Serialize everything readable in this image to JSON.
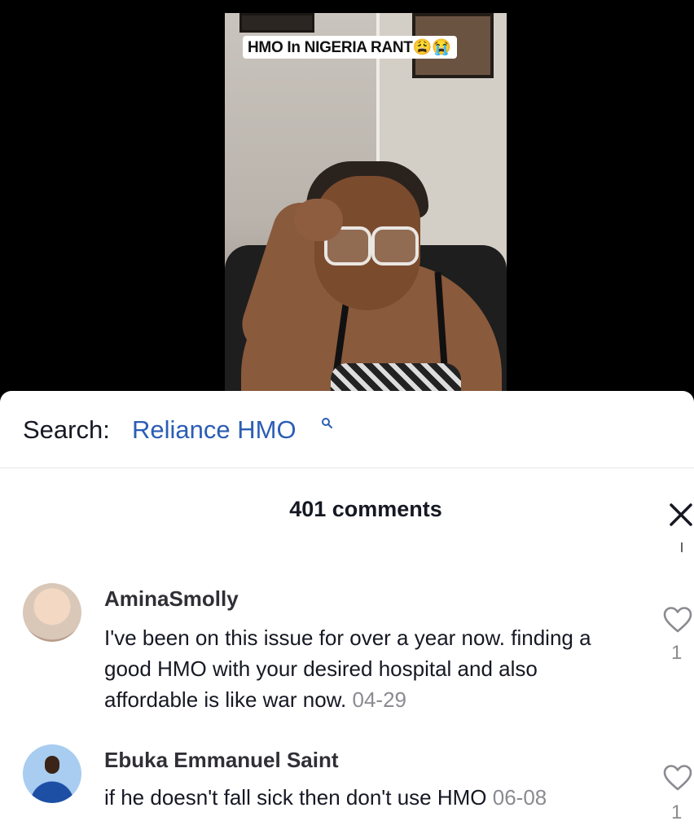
{
  "video": {
    "title": "HMO In NIGERIA RANT😩😭"
  },
  "search": {
    "label": "Search:",
    "term": "Reliance HMO"
  },
  "comments_header": {
    "count_label": "401 comments"
  },
  "comments": [
    {
      "username": "AminaSmolly",
      "text": "I've been on this issue for over a year now. finding a good HMO with your desired hospital and also affordable is like war now.",
      "date": "04-29",
      "likes": "1"
    },
    {
      "username": "Ebuka Emmanuel Saint",
      "text": "if he doesn't fall sick then don't use HMO",
      "date": "06-08",
      "likes": "1"
    }
  ],
  "icons": {
    "search": "search-icon",
    "close": "close-icon",
    "like": "heart-outline-icon"
  },
  "colors": {
    "search_term": "#2b5db5",
    "text_primary": "#161823",
    "text_secondary": "#8a8b91"
  }
}
